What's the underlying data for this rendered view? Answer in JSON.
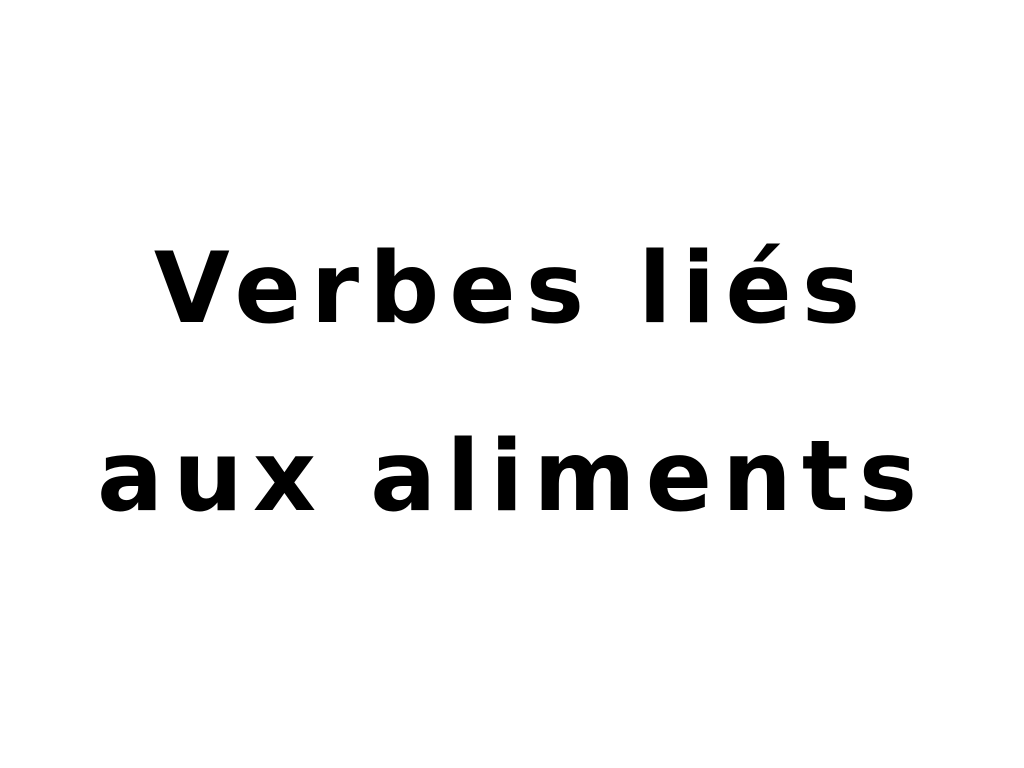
{
  "slide": {
    "title_lines": [
      "Verbes liés",
      "aux aliments"
    ]
  },
  "colors": {
    "background": "#ffffff",
    "text": "#000000"
  }
}
